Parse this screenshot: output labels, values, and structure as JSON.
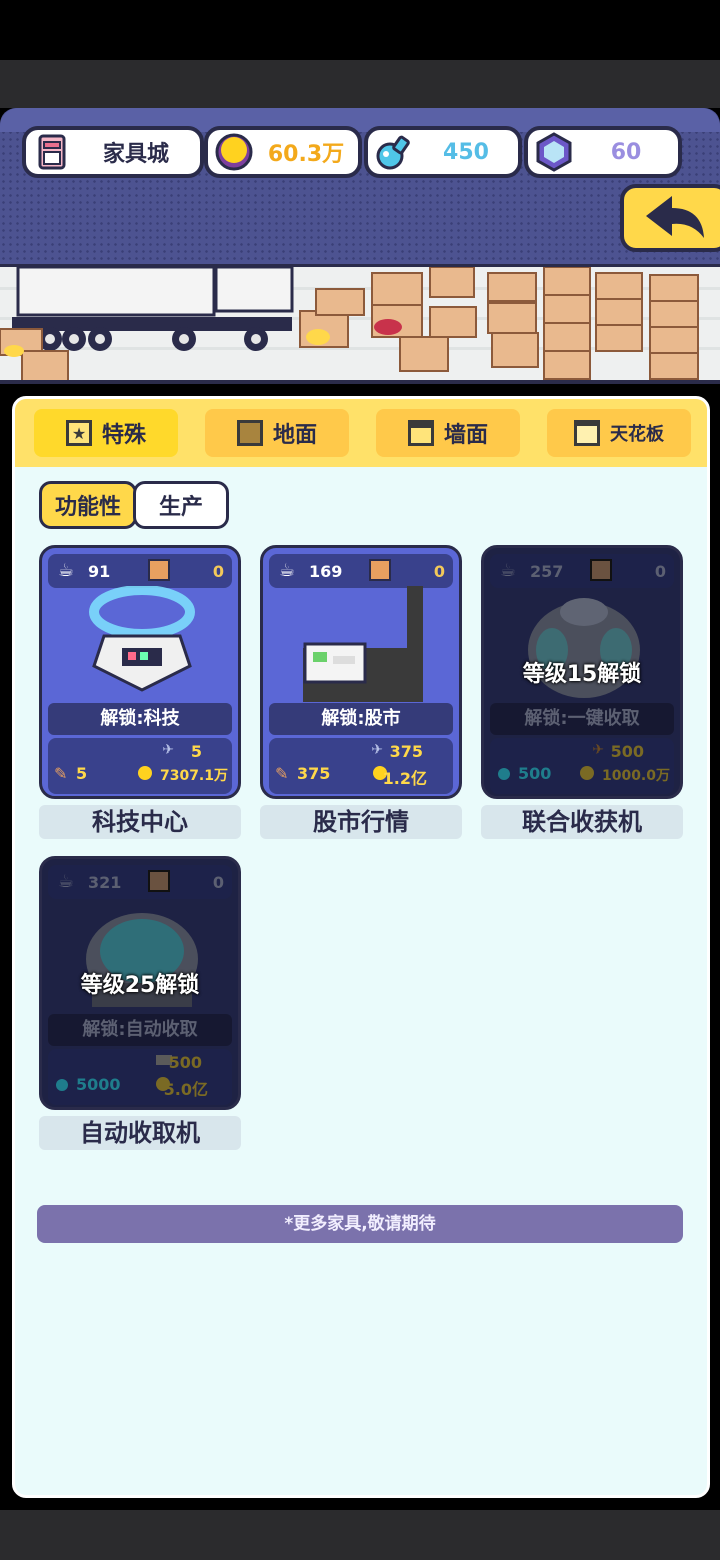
{
  "header": {
    "shop_name": "家具城",
    "gold": "60.3万",
    "potion": "450",
    "gem": "60"
  },
  "tabs": [
    {
      "label": "特殊",
      "active": true
    },
    {
      "label": "地面",
      "active": false
    },
    {
      "label": "墙面",
      "active": false
    },
    {
      "label": "天花板",
      "active": false
    }
  ],
  "subtabs": [
    {
      "label": "功能性",
      "active": true
    },
    {
      "label": "生产",
      "active": false
    }
  ],
  "items": [
    {
      "name": "科技中心",
      "level_num": "91",
      "count": "0",
      "unlock": "解锁:科技",
      "cost_a": "5",
      "cost_b": "5",
      "cost_c": "7307.1万",
      "locked": false,
      "lock_msg": ""
    },
    {
      "name": "股市行情",
      "level_num": "169",
      "count": "0",
      "unlock": "解锁:股市",
      "cost_a": "375",
      "cost_b": "375",
      "cost_c": "1.2亿",
      "locked": false,
      "lock_msg": ""
    },
    {
      "name": "联合收获机",
      "level_num": "257",
      "count": "0",
      "unlock": "解锁:一键收取",
      "cost_a": "500",
      "cost_b": "500",
      "cost_c": "1000.0万",
      "locked": true,
      "lock_msg": "等级15解锁"
    },
    {
      "name": "自动收取机",
      "level_num": "321",
      "count": "0",
      "unlock": "解锁:自动收取",
      "cost_a": "500",
      "cost_b": "5000",
      "cost_c": "5.0亿",
      "locked": true,
      "lock_msg": "等级25解锁"
    }
  ],
  "footer_note": "*更多家具,敬请期待",
  "colors": {
    "accent_yellow": "#ffd84a",
    "panel_bg": "#eafbfb",
    "header_bg": "#4d5391"
  }
}
